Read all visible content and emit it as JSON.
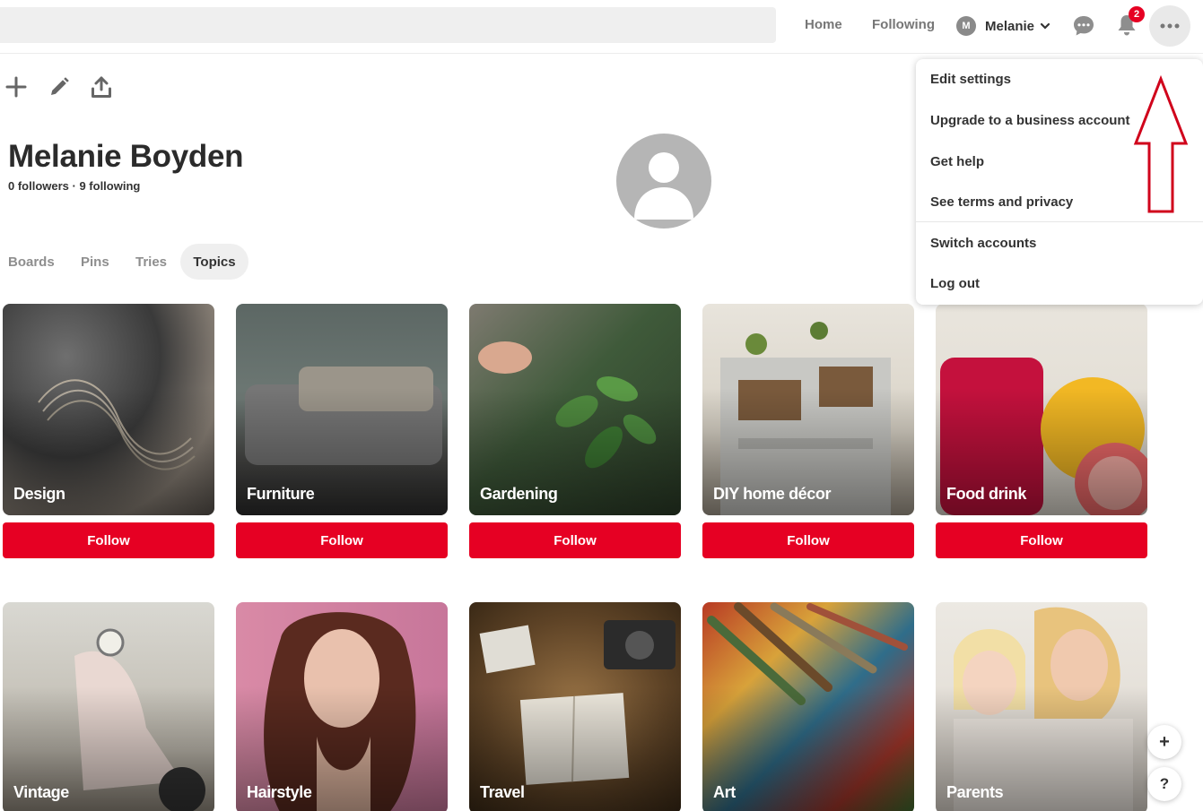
{
  "header": {
    "nav": {
      "home": "Home",
      "following": "Following"
    },
    "profile_chip": {
      "initial": "M",
      "name": "Melanie"
    },
    "notification_count": "2"
  },
  "icons": {
    "toolbar": [
      "plus-icon",
      "pencil-icon",
      "share-icon"
    ],
    "header": [
      "messages-icon",
      "bell-icon",
      "more-options-icon",
      "chevron-down-icon"
    ]
  },
  "profile": {
    "name": "Melanie Boyden",
    "stats": "0 followers · 9 following"
  },
  "tabs": [
    {
      "label": "Boards"
    },
    {
      "label": "Pins"
    },
    {
      "label": "Tries"
    },
    {
      "label": "Topics",
      "active": true
    }
  ],
  "topics": [
    {
      "label": "Design",
      "follow": "Follow"
    },
    {
      "label": "Furniture",
      "follow": "Follow"
    },
    {
      "label": "Gardening",
      "follow": "Follow"
    },
    {
      "label": "DIY home décor",
      "follow": "Follow"
    },
    {
      "label": "Food drink",
      "follow": "Follow"
    },
    {
      "label": "Vintage"
    },
    {
      "label": "Hairstyle"
    },
    {
      "label": "Travel"
    },
    {
      "label": "Art"
    },
    {
      "label": "Parents"
    }
  ],
  "menu": {
    "items": [
      {
        "label": "Edit settings"
      },
      {
        "label": "Upgrade to a business account"
      },
      {
        "label": "Get help"
      },
      {
        "label": "See terms and privacy"
      },
      {
        "label": "Switch accounts"
      },
      {
        "label": "Log out"
      }
    ]
  },
  "floating": {
    "add": "+",
    "help": "?"
  },
  "colors": {
    "accent": "#e60023",
    "arrow": "#d0021b"
  }
}
